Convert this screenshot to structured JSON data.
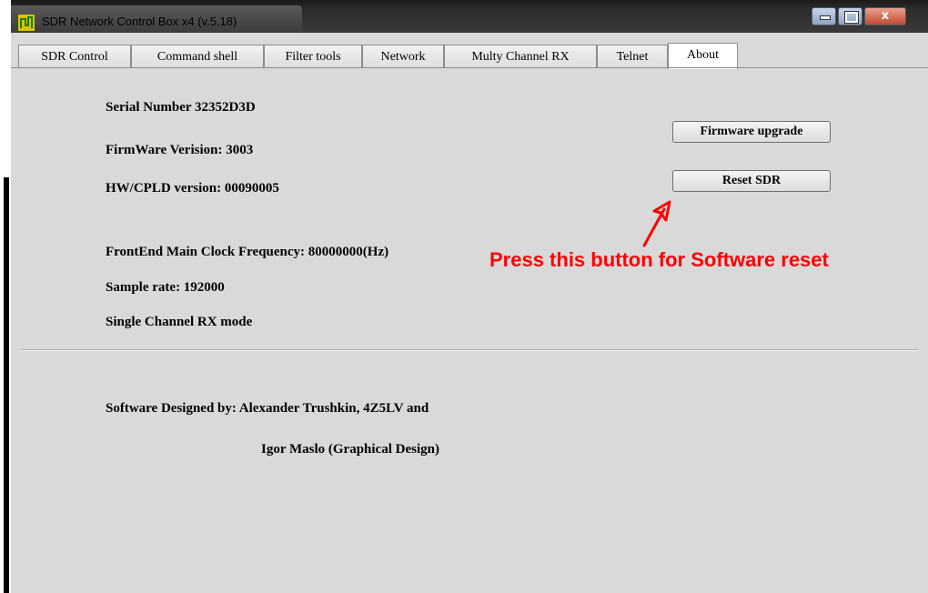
{
  "window": {
    "title": "SDR Network Control Box x4 (v.5.18)",
    "icon": "sdr-app-icon",
    "controls": {
      "minimize": "minimize-icon",
      "maximize": "maximize-icon",
      "close_glyph": "x"
    }
  },
  "tabs": [
    {
      "label": "SDR Control",
      "active": false
    },
    {
      "label": "Command shell",
      "active": false
    },
    {
      "label": "Filter tools",
      "active": false
    },
    {
      "label": "Network",
      "active": false
    },
    {
      "label": "Multy Channel RX",
      "active": false
    },
    {
      "label": "Telnet",
      "active": false
    },
    {
      "label": "About",
      "active": true
    }
  ],
  "about": {
    "serial_number": "Serial Number  32352D3D",
    "firmware_version": "FirmWare Verision: 3003",
    "hw_cpld_version": "HW/CPLD version: 00090005",
    "frontend_clock": "FrontEnd Main Clock Frequency:  80000000(Hz)",
    "sample_rate": "Sample rate:  192000",
    "rx_mode": "Single Channel RX mode",
    "designed_by": "Software Designed by:  Alexander Trushkin, 4Z5LV and",
    "graphical_design": "Igor Maslo (Graphical Design)"
  },
  "buttons": {
    "firmware_upgrade": "Firmware upgrade",
    "reset_sdr": "Reset SDR"
  },
  "annotation": {
    "text": "Press this button for Software reset",
    "color": "#ff0000",
    "arrow": "red-arrow-icon"
  },
  "colors": {
    "panel_bg": "#d9d9d9",
    "titlebar": "#2c2c2c",
    "close_button": "#c24a30"
  }
}
